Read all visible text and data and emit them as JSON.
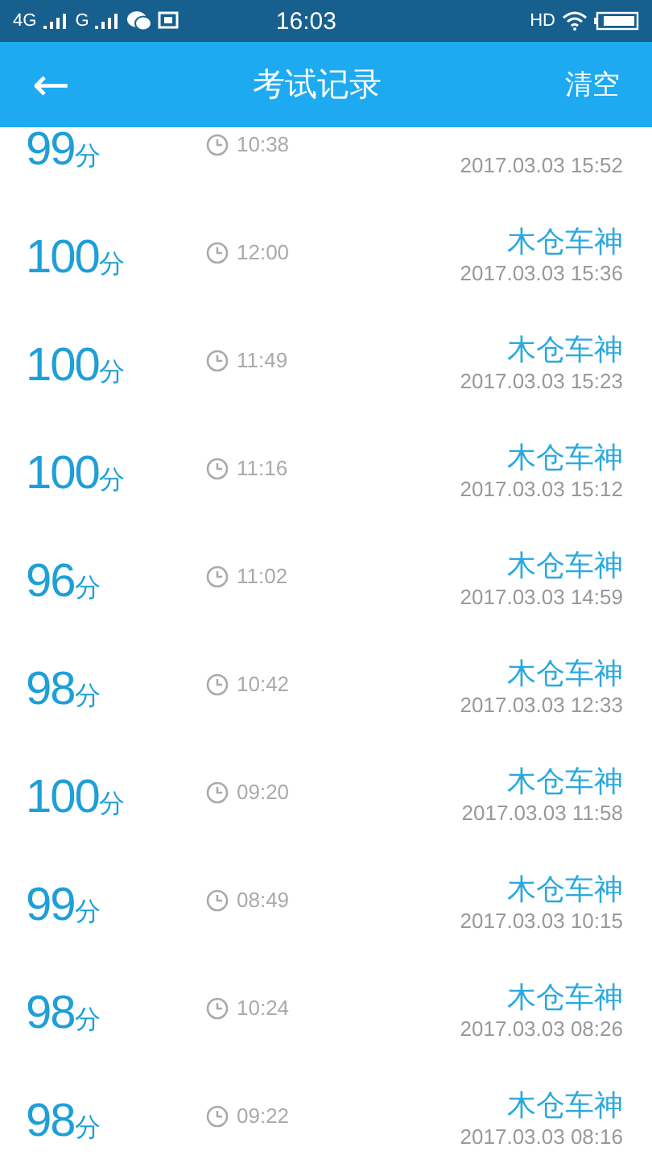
{
  "status_bar": {
    "network_1": "4G",
    "network_2": "G",
    "time": "16:03",
    "hd": "HD"
  },
  "header": {
    "back": "←",
    "title": "考试记录",
    "action": "清空"
  },
  "records": [
    {
      "score": "99",
      "unit": "分",
      "duration": "10:38",
      "date": "2017.03.03  15:52"
    },
    {
      "score": "100",
      "unit": "分",
      "duration": "12:00",
      "title": "木仓车神",
      "date": "2017.03.03  15:36"
    },
    {
      "score": "100",
      "unit": "分",
      "duration": "11:49",
      "title": "木仓车神",
      "date": "2017.03.03  15:23"
    },
    {
      "score": "100",
      "unit": "分",
      "duration": "11:16",
      "title": "木仓车神",
      "date": "2017.03.03  15:12"
    },
    {
      "score": "96",
      "unit": "分",
      "duration": "11:02",
      "title": "木仓车神",
      "date": "2017.03.03  14:59"
    },
    {
      "score": "98",
      "unit": "分",
      "duration": "10:42",
      "title": "木仓车神",
      "date": "2017.03.03  12:33"
    },
    {
      "score": "100",
      "unit": "分",
      "duration": "09:20",
      "title": "木仓车神",
      "date": "2017.03.03  11:58"
    },
    {
      "score": "99",
      "unit": "分",
      "duration": "08:49",
      "title": "木仓车神",
      "date": "2017.03.03  10:15"
    },
    {
      "score": "98",
      "unit": "分",
      "duration": "10:24",
      "title": "木仓车神",
      "date": "2017.03.03  08:26"
    },
    {
      "score": "98",
      "unit": "分",
      "duration": "09:22",
      "title": "木仓车神",
      "date": "2017.03.03  08:16"
    }
  ]
}
